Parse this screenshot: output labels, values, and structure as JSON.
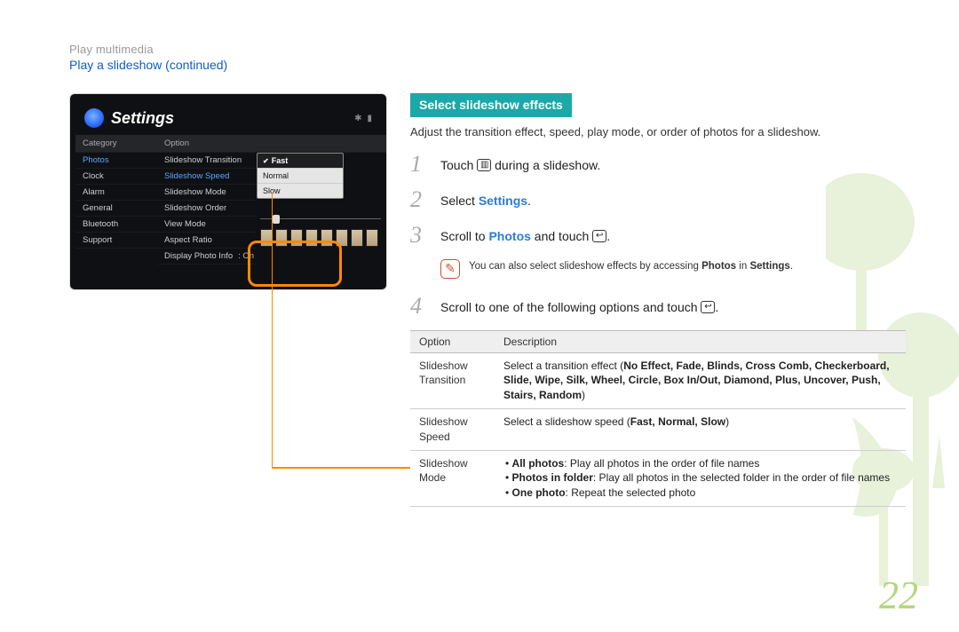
{
  "header": {
    "breadcrumb": "Play multimedia",
    "subtitle": "Play a slideshow  (continued)"
  },
  "mock": {
    "title": "Settings",
    "col_category": "Category",
    "col_option": "Option",
    "categories": [
      "Photos",
      "Clock",
      "Alarm",
      "General",
      "Bluetooth",
      "Support"
    ],
    "active_category": "Photos",
    "options": [
      "Slideshow Transition",
      "Slideshow Speed",
      "Slideshow Mode",
      "Slideshow Order",
      "View Mode",
      "Aspect Ratio",
      "Display Photo Info"
    ],
    "active_option": "Slideshow Speed",
    "info_value": ": On",
    "dropdown": [
      "Fast",
      "Normal",
      "Slow"
    ],
    "dropdown_selected": "Fast"
  },
  "right": {
    "section_title": "Select slideshow effects",
    "intro": "Adjust the transition effect, speed, play mode, or order of photos for a slideshow.",
    "step1_a": "Touch ",
    "step1_b": " during a slideshow.",
    "step2_a": "Select ",
    "step2_b": "Settings",
    "step2_c": ".",
    "step3_a": "Scroll to ",
    "step3_b": "Photos",
    "step3_c": " and touch ",
    "step3_d": ".",
    "note_a": "You can also select slideshow effects by accessing ",
    "note_b": "Photos",
    "note_c": " in ",
    "note_d": "Settings",
    "note_e": ".",
    "step4_a": "Scroll to one of the following options and touch ",
    "step4_b": ".",
    "table": {
      "h1": "Option",
      "h2": "Description",
      "r1_name": "Slideshow Transition",
      "r1_lead": "Select a transition effect (",
      "r1_opts": "No Effect, Fade, Blinds, Cross Comb, Checkerboard, Slide, Wipe, Silk, Wheel, Circle, Box In/Out, Diamond, Plus, Uncover, Push, Stairs, Random",
      "r1_tail": ")",
      "r2_name": "Slideshow Speed",
      "r2_lead": "Select a slideshow speed (",
      "r2_opts": "Fast, Normal, Slow",
      "r2_tail": ")",
      "r3_name": "Slideshow Mode",
      "r3_li1_b": "All photos",
      "r3_li1_t": ": Play all photos in the order of file names",
      "r3_li2_b": "Photos in folder",
      "r3_li2_t": ": Play all photos in the selected folder in the order of file names",
      "r3_li3_b": "One photo",
      "r3_li3_t": ": Repeat the selected photo"
    }
  },
  "page_number": "22"
}
